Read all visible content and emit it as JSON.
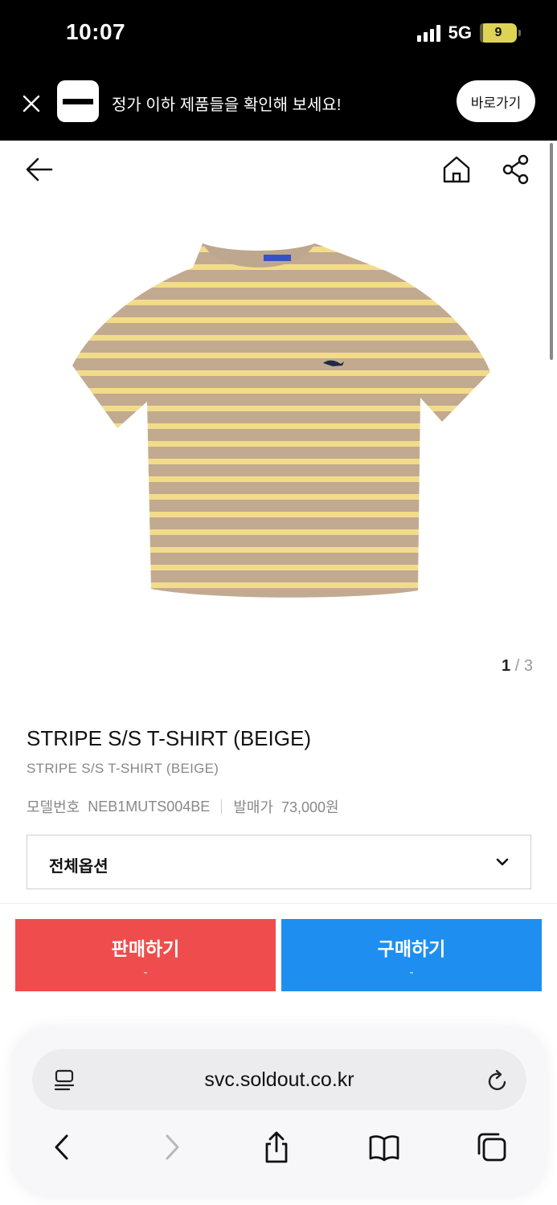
{
  "status_bar": {
    "time": "10:07",
    "network": "5G",
    "battery": "9",
    "battery_level": 0.09
  },
  "banner": {
    "text": "정가 이하 제품들을 확인해 보세요!",
    "button_label": "바로가기"
  },
  "header": {
    "icons": [
      "back-arrow-icon",
      "home-icon",
      "share-icon"
    ]
  },
  "gallery": {
    "current": "1",
    "separator": "/",
    "total": "3"
  },
  "product": {
    "title": "STRIPE S/S T-SHIRT (BEIGE)",
    "subtitle": "STRIPE S/S T-SHIRT (BEIGE)",
    "model_label": "모델번호",
    "model_value": "NEB1MUTS004BE",
    "price_label": "발매가",
    "price_value": "73,000원",
    "colors": {
      "stripe_dark": "#c2aa90",
      "stripe_light": "#f2dc8a"
    }
  },
  "options": {
    "selected": "전체옵션"
  },
  "actions": {
    "sell_label": "판매하기",
    "sell_sub": "-",
    "buy_label": "구매하기",
    "buy_sub": "-",
    "colors": {
      "sell": "#ef4d4d",
      "buy": "#1e8ff0"
    }
  },
  "browser": {
    "url": "svc.soldout.co.kr",
    "icons": [
      "reader-icon",
      "reload-icon",
      "back-icon",
      "forward-icon",
      "share-icon",
      "bookmarks-icon",
      "tabs-icon"
    ]
  }
}
